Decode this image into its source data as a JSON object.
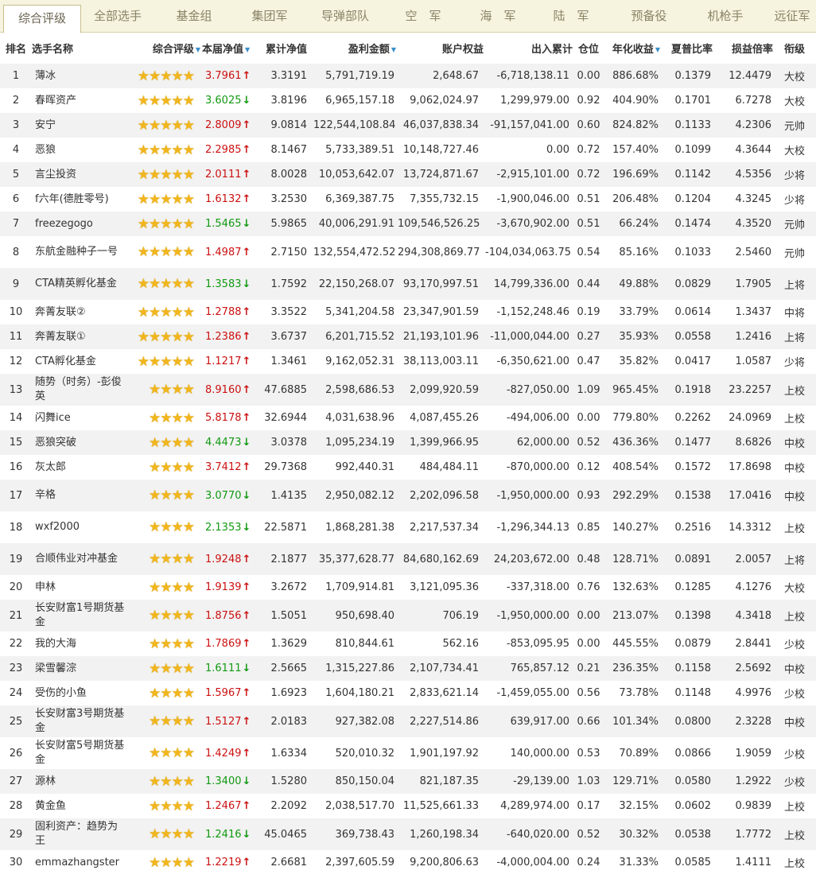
{
  "tabs": [
    {
      "label": "综合评级",
      "active": true
    },
    {
      "label": "全部选手",
      "active": false
    },
    {
      "label": "基金组",
      "active": false
    },
    {
      "label": "集团军",
      "active": false
    },
    {
      "label": "导弹部队",
      "active": false
    },
    {
      "label": "空　军",
      "active": false
    },
    {
      "label": "海　军",
      "active": false
    },
    {
      "label": "陆　军",
      "active": false
    },
    {
      "label": "预备役",
      "active": false
    },
    {
      "label": "机枪手",
      "active": false
    },
    {
      "label": "远征军",
      "active": false
    }
  ],
  "columns": [
    {
      "key": "rank",
      "label": "排名",
      "sortable": false
    },
    {
      "key": "name",
      "label": "选手名称",
      "sortable": false
    },
    {
      "key": "rating",
      "label": "综合评级",
      "sortable": true
    },
    {
      "key": "nav",
      "label": "本届净值",
      "sortable": true
    },
    {
      "key": "cum_nav",
      "label": "累计净值",
      "sortable": false
    },
    {
      "key": "profit",
      "label": "盈利金额",
      "sortable": true
    },
    {
      "key": "equity",
      "label": "账户权益",
      "sortable": false
    },
    {
      "key": "flow",
      "label": "出入累计",
      "sortable": false
    },
    {
      "key": "position",
      "label": "仓位",
      "sortable": false
    },
    {
      "key": "annual",
      "label": "年化收益",
      "sortable": true
    },
    {
      "key": "sharpe",
      "label": "夏普比率",
      "sortable": false
    },
    {
      "key": "pl_ratio",
      "label": "损益倍率",
      "sortable": false
    },
    {
      "key": "title",
      "label": "衔级",
      "sortable": false
    }
  ],
  "colors": {
    "up": "#cc1111",
    "down": "#119911",
    "star": "#f2b61d",
    "sort_icon": "#3a8fc9",
    "row_alt": "#f2f2f2"
  },
  "icons": {
    "star": "star-icon",
    "up": "arrow-up-icon",
    "down": "arrow-down-icon",
    "sort": "sort-desc-icon"
  },
  "rows": [
    {
      "rank": "1",
      "name": "薄冰",
      "stars": 5,
      "nav": "3.7961",
      "dir": "up",
      "cum_nav": "3.3191",
      "profit": "5,791,719.19",
      "equity": "2,648.67",
      "flow": "-6,718,138.11",
      "position": "0.00",
      "annual": "886.68%",
      "sharpe": "0.1379",
      "pl_ratio": "12.4479",
      "title": "大校"
    },
    {
      "rank": "2",
      "name": "春晖资产",
      "stars": 5,
      "nav": "3.6025",
      "dir": "down",
      "cum_nav": "3.8196",
      "profit": "6,965,157.18",
      "equity": "9,062,024.97",
      "flow": "1,299,979.00",
      "position": "0.92",
      "annual": "404.90%",
      "sharpe": "0.1701",
      "pl_ratio": "6.7278",
      "title": "大校"
    },
    {
      "rank": "3",
      "name": "安宁",
      "stars": 5,
      "nav": "2.8009",
      "dir": "up",
      "cum_nav": "9.0814",
      "profit": "122,544,108.84",
      "equity": "46,037,838.34",
      "flow": "-91,157,041.00",
      "position": "0.60",
      "annual": "824.82%",
      "sharpe": "0.1133",
      "pl_ratio": "4.2306",
      "title": "元帅"
    },
    {
      "rank": "4",
      "name": "恶狼",
      "stars": 5,
      "nav": "2.2985",
      "dir": "up",
      "cum_nav": "8.1467",
      "profit": "5,733,389.51",
      "equity": "10,148,727.46",
      "flow": "0.00",
      "position": "0.72",
      "annual": "157.40%",
      "sharpe": "0.1099",
      "pl_ratio": "4.3644",
      "title": "大校"
    },
    {
      "rank": "5",
      "name": "言尘投资",
      "stars": 5,
      "nav": "2.0111",
      "dir": "up",
      "cum_nav": "8.0028",
      "profit": "10,053,642.07",
      "equity": "13,724,871.67",
      "flow": "-2,915,101.00",
      "position": "0.72",
      "annual": "196.69%",
      "sharpe": "0.1142",
      "pl_ratio": "4.5356",
      "title": "少将"
    },
    {
      "rank": "6",
      "name": "f六年(德胜零号)",
      "stars": 5,
      "nav": "1.6132",
      "dir": "up",
      "cum_nav": "3.2530",
      "profit": "6,369,387.75",
      "equity": "7,355,732.15",
      "flow": "-1,900,046.00",
      "position": "0.51",
      "annual": "206.48%",
      "sharpe": "0.1204",
      "pl_ratio": "4.3245",
      "title": "少将"
    },
    {
      "rank": "7",
      "name": "freezegogo",
      "stars": 5,
      "nav": "1.5465",
      "dir": "down",
      "cum_nav": "5.9865",
      "profit": "40,006,291.91",
      "equity": "109,546,526.25",
      "flow": "-3,670,902.00",
      "position": "0.51",
      "annual": "66.24%",
      "sharpe": "0.1474",
      "pl_ratio": "4.3520",
      "title": "元帅"
    },
    {
      "rank": "8",
      "name": "东航金融种子一号",
      "stars": 5,
      "nav": "1.4987",
      "dir": "up",
      "cum_nav": "2.7150",
      "profit": "132,554,472.52",
      "equity": "294,308,869.77",
      "flow": "-104,034,063.75",
      "position": "0.54",
      "annual": "85.16%",
      "sharpe": "0.1033",
      "pl_ratio": "2.5460",
      "title": "元帅"
    },
    {
      "rank": "9",
      "name": "CTA精英孵化基金",
      "stars": 5,
      "nav": "1.3583",
      "dir": "down",
      "cum_nav": "1.7592",
      "profit": "22,150,268.07",
      "equity": "93,170,997.51",
      "flow": "14,799,336.00",
      "position": "0.44",
      "annual": "49.88%",
      "sharpe": "0.0829",
      "pl_ratio": "1.7905",
      "title": "上将"
    },
    {
      "rank": "10",
      "name": "奔菁友联②",
      "stars": 5,
      "nav": "1.2788",
      "dir": "up",
      "cum_nav": "3.3522",
      "profit": "5,341,204.58",
      "equity": "23,347,901.59",
      "flow": "-1,152,248.46",
      "position": "0.19",
      "annual": "33.79%",
      "sharpe": "0.0614",
      "pl_ratio": "1.3437",
      "title": "中将"
    },
    {
      "rank": "11",
      "name": "奔菁友联①",
      "stars": 5,
      "nav": "1.2386",
      "dir": "up",
      "cum_nav": "3.6737",
      "profit": "6,201,715.52",
      "equity": "21,193,101.96",
      "flow": "-11,000,044.00",
      "position": "0.27",
      "annual": "35.93%",
      "sharpe": "0.0558",
      "pl_ratio": "1.2416",
      "title": "上将"
    },
    {
      "rank": "12",
      "name": "CTA孵化基金",
      "stars": 5,
      "nav": "1.1217",
      "dir": "up",
      "cum_nav": "1.3461",
      "profit": "9,162,052.31",
      "equity": "38,113,003.11",
      "flow": "-6,350,621.00",
      "position": "0.47",
      "annual": "35.82%",
      "sharpe": "0.0417",
      "pl_ratio": "1.0587",
      "title": "少将"
    },
    {
      "rank": "13",
      "name": "随势（时务）-彭俊英",
      "stars": 4,
      "nav": "8.9160",
      "dir": "up",
      "cum_nav": "47.6885",
      "profit": "2,598,686.53",
      "equity": "2,099,920.59",
      "flow": "-827,050.00",
      "position": "1.09",
      "annual": "965.45%",
      "sharpe": "0.1918",
      "pl_ratio": "23.2257",
      "title": "上校"
    },
    {
      "rank": "14",
      "name": "闪舞ice",
      "stars": 4,
      "nav": "5.8178",
      "dir": "up",
      "cum_nav": "32.6944",
      "profit": "4,031,638.96",
      "equity": "4,087,455.26",
      "flow": "-494,006.00",
      "position": "0.00",
      "annual": "779.80%",
      "sharpe": "0.2262",
      "pl_ratio": "24.0969",
      "title": "上校"
    },
    {
      "rank": "15",
      "name": "恶狼突破",
      "stars": 4,
      "nav": "4.4473",
      "dir": "down",
      "cum_nav": "3.0378",
      "profit": "1,095,234.19",
      "equity": "1,399,966.95",
      "flow": "62,000.00",
      "position": "0.52",
      "annual": "436.36%",
      "sharpe": "0.1477",
      "pl_ratio": "8.6826",
      "title": "中校"
    },
    {
      "rank": "16",
      "name": "灰太郎",
      "stars": 4,
      "nav": "3.7412",
      "dir": "up",
      "cum_nav": "29.7368",
      "profit": "992,440.31",
      "equity": "484,484.11",
      "flow": "-870,000.00",
      "position": "0.12",
      "annual": "408.54%",
      "sharpe": "0.1572",
      "pl_ratio": "17.8698",
      "title": "中校"
    },
    {
      "rank": "17",
      "name": "辛格",
      "stars": 4,
      "nav": "3.0770",
      "dir": "down",
      "cum_nav": "1.4135",
      "profit": "2,950,082.12",
      "equity": "2,202,096.58",
      "flow": "-1,950,000.00",
      "position": "0.93",
      "annual": "292.29%",
      "sharpe": "0.1538",
      "pl_ratio": "17.0416",
      "title": "中校"
    },
    {
      "rank": "18",
      "name": "wxf2000",
      "stars": 4,
      "nav": "2.1353",
      "dir": "down",
      "cum_nav": "22.5871",
      "profit": "1,868,281.38",
      "equity": "2,217,537.34",
      "flow": "-1,296,344.13",
      "position": "0.85",
      "annual": "140.27%",
      "sharpe": "0.2516",
      "pl_ratio": "14.3312",
      "title": "上校"
    },
    {
      "rank": "19",
      "name": "合顺伟业对冲基金",
      "stars": 4,
      "nav": "1.9248",
      "dir": "up",
      "cum_nav": "2.1877",
      "profit": "35,377,628.77",
      "equity": "84,680,162.69",
      "flow": "24,203,672.00",
      "position": "0.48",
      "annual": "128.71%",
      "sharpe": "0.0891",
      "pl_ratio": "2.0057",
      "title": "上将"
    },
    {
      "rank": "20",
      "name": "申林",
      "stars": 4,
      "nav": "1.9139",
      "dir": "up",
      "cum_nav": "3.2672",
      "profit": "1,709,914.81",
      "equity": "3,121,095.36",
      "flow": "-337,318.00",
      "position": "0.76",
      "annual": "132.63%",
      "sharpe": "0.1285",
      "pl_ratio": "4.1276",
      "title": "大校"
    },
    {
      "rank": "21",
      "name": "长安财富1号期货基金",
      "stars": 4,
      "nav": "1.8756",
      "dir": "up",
      "cum_nav": "1.5051",
      "profit": "950,698.40",
      "equity": "706.19",
      "flow": "-1,950,000.00",
      "position": "0.00",
      "annual": "213.07%",
      "sharpe": "0.1398",
      "pl_ratio": "4.3418",
      "title": "上校"
    },
    {
      "rank": "22",
      "name": "我的大海",
      "stars": 4,
      "nav": "1.7869",
      "dir": "up",
      "cum_nav": "1.3629",
      "profit": "810,844.61",
      "equity": "562.16",
      "flow": "-853,095.95",
      "position": "0.00",
      "annual": "445.55%",
      "sharpe": "0.0879",
      "pl_ratio": "2.8441",
      "title": "少校"
    },
    {
      "rank": "23",
      "name": "梁雪馨淙",
      "stars": 4,
      "nav": "1.6111",
      "dir": "down",
      "cum_nav": "2.5665",
      "profit": "1,315,227.86",
      "equity": "2,107,734.41",
      "flow": "765,857.12",
      "position": "0.21",
      "annual": "236.35%",
      "sharpe": "0.1158",
      "pl_ratio": "2.5692",
      "title": "中校"
    },
    {
      "rank": "24",
      "name": "受伤的小鱼",
      "stars": 4,
      "nav": "1.5967",
      "dir": "up",
      "cum_nav": "1.6923",
      "profit": "1,604,180.21",
      "equity": "2,833,621.14",
      "flow": "-1,459,055.00",
      "position": "0.56",
      "annual": "73.78%",
      "sharpe": "0.1148",
      "pl_ratio": "4.9976",
      "title": "少校"
    },
    {
      "rank": "25",
      "name": "长安财富3号期货基金",
      "stars": 4,
      "nav": "1.5127",
      "dir": "up",
      "cum_nav": "2.0183",
      "profit": "927,382.08",
      "equity": "2,227,514.86",
      "flow": "639,917.00",
      "position": "0.66",
      "annual": "101.34%",
      "sharpe": "0.0800",
      "pl_ratio": "2.3228",
      "title": "中校"
    },
    {
      "rank": "26",
      "name": "长安财富5号期货基金",
      "stars": 4,
      "nav": "1.4249",
      "dir": "up",
      "cum_nav": "1.6334",
      "profit": "520,010.32",
      "equity": "1,901,197.92",
      "flow": "140,000.00",
      "position": "0.53",
      "annual": "70.89%",
      "sharpe": "0.0866",
      "pl_ratio": "1.9059",
      "title": "少校"
    },
    {
      "rank": "27",
      "name": "源林",
      "stars": 4,
      "nav": "1.3400",
      "dir": "down",
      "cum_nav": "1.5280",
      "profit": "850,150.04",
      "equity": "821,187.35",
      "flow": "-29,139.00",
      "position": "1.03",
      "annual": "129.71%",
      "sharpe": "0.0580",
      "pl_ratio": "1.2922",
      "title": "少校"
    },
    {
      "rank": "28",
      "name": "黄金鱼",
      "stars": 4,
      "nav": "1.2467",
      "dir": "up",
      "cum_nav": "2.2092",
      "profit": "2,038,517.70",
      "equity": "11,525,661.33",
      "flow": "4,289,974.00",
      "position": "0.17",
      "annual": "32.15%",
      "sharpe": "0.0602",
      "pl_ratio": "0.9839",
      "title": "上校"
    },
    {
      "rank": "29",
      "name": "固利资产：趋势为王",
      "stars": 4,
      "nav": "1.2416",
      "dir": "down",
      "cum_nav": "45.0465",
      "profit": "369,738.43",
      "equity": "1,260,198.34",
      "flow": "-640,020.00",
      "position": "0.52",
      "annual": "30.32%",
      "sharpe": "0.0538",
      "pl_ratio": "1.7772",
      "title": "上校"
    },
    {
      "rank": "30",
      "name": "emmazhangster",
      "stars": 4,
      "nav": "1.2219",
      "dir": "up",
      "cum_nav": "2.6681",
      "profit": "2,397,605.59",
      "equity": "9,200,806.63",
      "flow": "-4,000,004.00",
      "position": "0.24",
      "annual": "31.33%",
      "sharpe": "0.0585",
      "pl_ratio": "1.4111",
      "title": "上校"
    }
  ]
}
